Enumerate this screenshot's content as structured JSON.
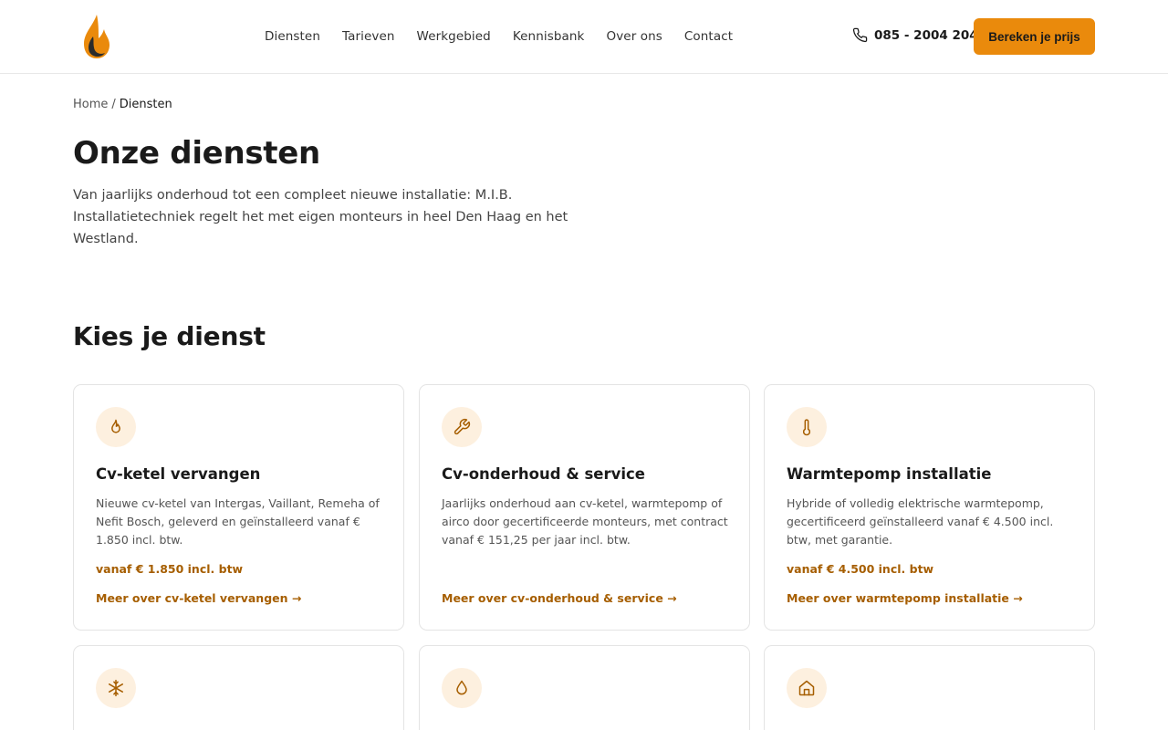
{
  "header": {
    "nav": [
      "Diensten",
      "Tarieven",
      "Werkgebied",
      "Kennisbank",
      "Over ons",
      "Contact"
    ],
    "phone": "085 - 2004 204",
    "cta_label": "Bereken je prijs"
  },
  "breadcrumb": {
    "home": "Home",
    "separator": "/",
    "current": "Diensten"
  },
  "hero": {
    "title": "Onze diensten",
    "intro": "Van jaarlijks onderhoud tot een compleet nieuwe installatie: M.I.B. Installatietechniek regelt het met eigen monteurs in heel Den Haag en het Westland."
  },
  "services": {
    "title": "Kies je dienst",
    "cards": [
      {
        "icon": "flame-icon",
        "title": "Cv-ketel vervangen",
        "desc": "Nieuwe cv-ketel van Intergas, Vaillant, Remeha of Nefit Bosch, geleverd en geïnstalleerd vanaf € 1.850 incl. btw.",
        "price": "vanaf € 1.850 incl. btw",
        "link": "Meer over cv-ketel vervangen →"
      },
      {
        "icon": "wrench-icon",
        "title": "Cv-onderhoud & service",
        "desc": "Jaarlijks onderhoud aan cv-ketel, warmtepomp of airco door gecertificeerde monteurs, met contract vanaf € 151,25 per jaar incl. btw.",
        "price": "",
        "link": "Meer over cv-onderhoud & service →"
      },
      {
        "icon": "thermometer-icon",
        "title": "Warmtepomp installatie",
        "desc": "Hybride of volledig elektrische warmtepomp, gecertificeerd geïnstalleerd vanaf € 4.500 incl. btw, met garantie.",
        "price": "vanaf € 4.500 incl. btw",
        "link": "Meer over warmtepomp installatie →"
      },
      {
        "icon": "snowflake-icon"
      },
      {
        "icon": "droplet-icon"
      },
      {
        "icon": "house-icon"
      }
    ]
  },
  "colors": {
    "accent": "#ea8a0c",
    "accent_text": "#a65e00",
    "icon_bg": "#fdf0df"
  }
}
